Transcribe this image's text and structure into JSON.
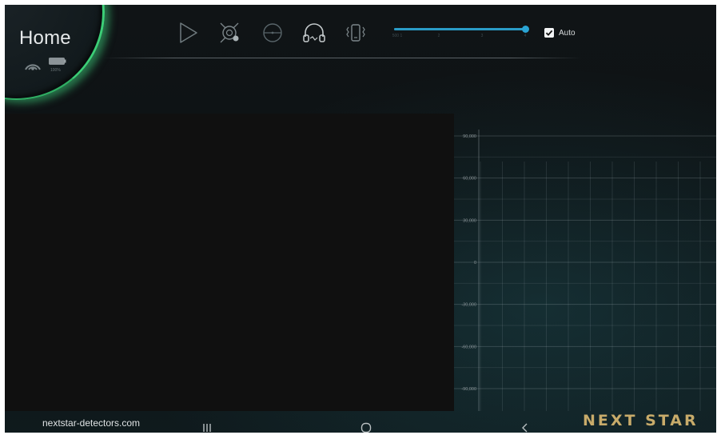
{
  "header": {
    "title": "Home",
    "battery_percent": "100%"
  },
  "toolbar": {
    "icons": [
      "play-icon",
      "target-sensor-icon",
      "disc-sweep-icon",
      "headphones-icon",
      "vibration-icon"
    ],
    "slider": {
      "tick_labels": [
        "500 1",
        "2",
        "3",
        "4"
      ],
      "value_fraction": 1.0
    },
    "auto_label": "Auto",
    "auto_checked": true
  },
  "chart_data": {
    "type": "line",
    "y_ticks": [
      "90,000",
      "60,000",
      "30,000",
      "0",
      "-30,000",
      "-60,000",
      "-90,000"
    ],
    "y_values": [
      90000,
      60000,
      30000,
      0,
      -30000,
      -60000,
      -90000
    ],
    "ylim": [
      -90000,
      90000
    ],
    "grid": true,
    "series": []
  },
  "footer": {
    "site_url": "nextstar-detectors.com",
    "brand": "NEXT STAR",
    "nav": [
      "recent-apps-icon",
      "home-circle-icon",
      "back-chevron-icon"
    ]
  },
  "colors": {
    "accent_green": "#3ccf77",
    "slider_blue": "#2a9cc7",
    "brand_gold": "#c8ab6a"
  }
}
